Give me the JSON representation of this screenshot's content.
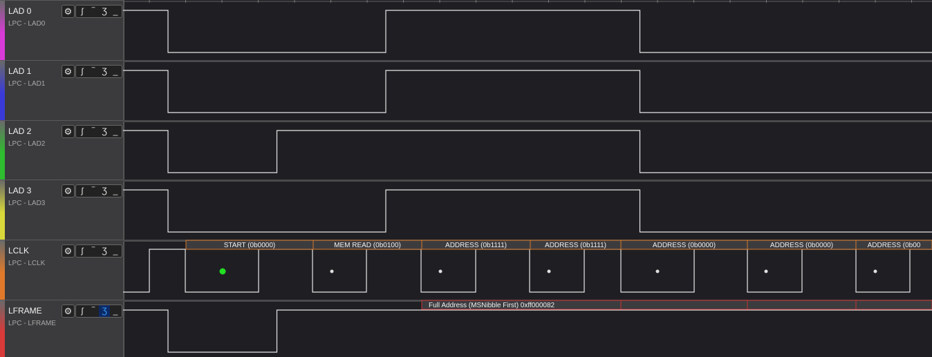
{
  "channels": [
    {
      "name": "LAD 0",
      "sub": "LPC - LAD0",
      "color": "#d83ad8",
      "active_trigger": null,
      "levels": [
        1,
        0,
        0,
        0,
        0,
        0,
        0,
        1,
        1,
        1,
        1,
        1,
        1,
        1,
        0,
        0,
        0,
        0,
        0,
        0,
        0,
        0,
        0,
        0,
        0,
        0,
        0,
        0,
        0,
        0,
        0,
        0,
        0,
        0,
        0,
        0,
        0,
        0,
        0,
        0,
        0,
        0,
        0,
        0
      ]
    },
    {
      "name": "LAD 1",
      "sub": "LPC - LAD1",
      "color": "#3a3ad8",
      "active_trigger": null,
      "levels": [
        1,
        0,
        0,
        0,
        0,
        0,
        0,
        1,
        1,
        1,
        1,
        1,
        1,
        1,
        0,
        0,
        0,
        0,
        0,
        0,
        0,
        0,
        0,
        0,
        0,
        0,
        0,
        0,
        0,
        0,
        0,
        0,
        0,
        0,
        0,
        0,
        0,
        0,
        0,
        0,
        0,
        0,
        0,
        0
      ]
    },
    {
      "name": "LAD 2",
      "sub": "LPC - LAD2",
      "color": "#2ebd2e",
      "active_trigger": null,
      "levels": [
        1,
        0,
        0,
        0,
        1,
        1,
        1,
        1,
        1,
        1,
        1,
        1,
        1,
        1,
        0,
        0,
        0,
        0,
        0,
        0,
        0,
        0,
        0,
        0,
        0,
        0,
        0,
        0,
        0,
        0,
        0,
        0,
        0,
        0,
        0,
        0,
        0,
        0,
        0,
        0,
        0,
        0,
        0,
        0
      ]
    },
    {
      "name": "LAD 3",
      "sub": "LPC - LAD3",
      "color": "#d8d83a",
      "active_trigger": null,
      "levels": [
        1,
        0,
        0,
        0,
        0,
        0,
        0,
        1,
        1,
        1,
        1,
        1,
        1,
        1,
        0,
        0,
        0,
        0,
        0,
        0,
        0,
        0,
        0,
        0,
        0,
        0,
        0,
        0,
        0,
        0,
        0,
        0,
        0,
        0,
        0,
        0,
        0,
        0,
        0,
        0,
        0,
        0,
        0,
        0
      ]
    },
    {
      "name": "LCLK",
      "sub": "LPC - LCLK",
      "color": "#e07a2a",
      "active_trigger": null,
      "clock": true
    },
    {
      "name": "LFRAME",
      "sub": "LPC - LFRAME",
      "color": "#d83a3a",
      "active_trigger": "falling",
      "levels": [
        1,
        0,
        0,
        0,
        1,
        1,
        1,
        1,
        1,
        1,
        1,
        1,
        1,
        1,
        1,
        1,
        1,
        1,
        1,
        1,
        1,
        1,
        1,
        1,
        1,
        1,
        1,
        1,
        1,
        1,
        1,
        1,
        1,
        1,
        1,
        1,
        1,
        1,
        1,
        1,
        1,
        1,
        1,
        1
      ]
    }
  ],
  "trigger_icons": [
    "rising-edge-icon",
    "high-level-icon",
    "falling-edge-icon",
    "low-level-icon"
  ],
  "lclk_annotations": [
    {
      "label": "START (0b0000)",
      "dot_color": "#22e022"
    },
    {
      "label": "MEM READ (0b0100)",
      "dot_color": "#e0e0e0"
    },
    {
      "label": "ADDRESS (0b1111)",
      "dot_color": "#e0e0e0"
    },
    {
      "label": "ADDRESS (0b1111)",
      "dot_color": "#e0e0e0"
    },
    {
      "label": "ADDRESS (0b0000)",
      "dot_color": "#e0e0e0"
    },
    {
      "label": "ADDRESS (0b0000)",
      "dot_color": "#e0e0e0"
    },
    {
      "label": "ADDRESS (0b00",
      "dot_color": "#e0e0e0"
    }
  ],
  "lframe_annotation": {
    "label": "Full Address (MSNibble First) 0xff000082"
  },
  "colors": {
    "wave": "#e8e8e8",
    "annotation_orange": "#d7792a",
    "annotation_red": "#c83232",
    "annotation_bg": "#3c3c3f"
  }
}
